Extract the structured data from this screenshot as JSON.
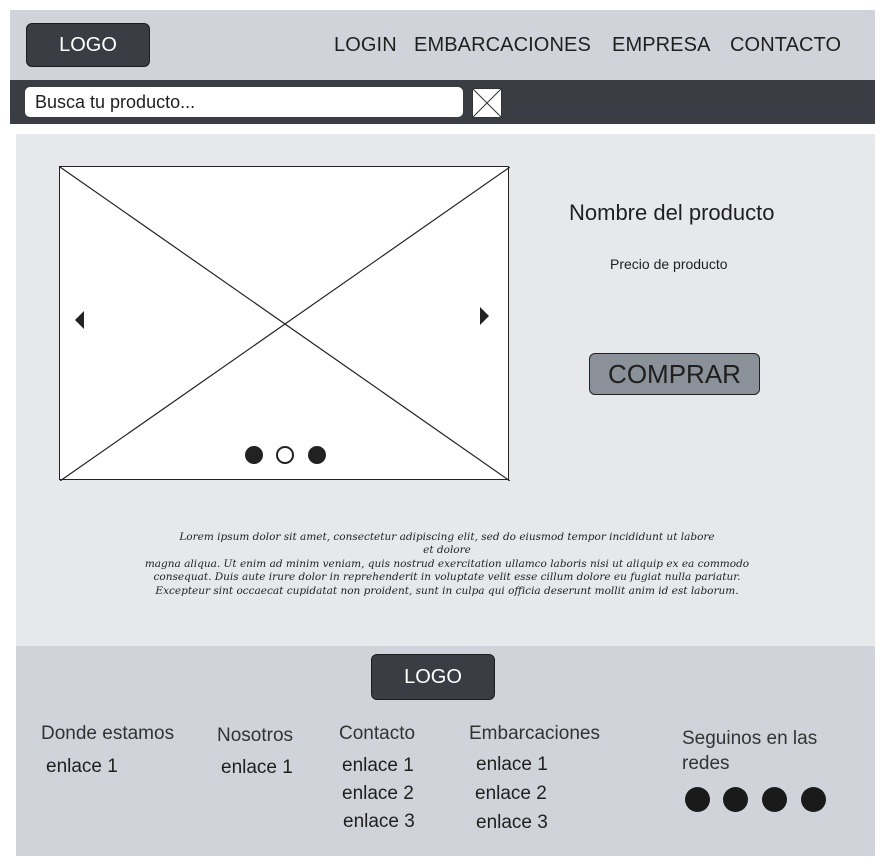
{
  "header": {
    "logo": "LOGO",
    "nav": [
      "LOGIN",
      "EMBARCACIONES",
      "EMPRESA",
      "CONTACTO"
    ]
  },
  "search": {
    "placeholder": "Busca tu producto..."
  },
  "product": {
    "carousel": {
      "slide_count": 3,
      "active_slide": 2
    },
    "name": "Nombre del producto",
    "price": "Precio de producto",
    "buy_label": "COMPRAR",
    "description": [
      "Lorem ipsum dolor sit amet, consectetur adipiscing elit, sed do eiusmod tempor incididunt ut labore",
      "et dolore",
      "magna aliqua. Ut enim ad minim veniam, quis nostrud exercitation ullamco laboris nisi ut aliquip ex ea commodo",
      "consequat. Duis aute irure dolor in reprehenderit in voluptate velit esse cillum dolore eu fugiat nulla pariatur.",
      "Excepteur sint occaecat cupidatat non proident, sunt in culpa qui officia deserunt mollit anim id est laborum."
    ]
  },
  "footer": {
    "logo": "LOGO",
    "columns": [
      {
        "title": "Donde estamos",
        "links": [
          "enlace 1"
        ]
      },
      {
        "title": "Nosotros",
        "links": [
          "enlace 1"
        ]
      },
      {
        "title": "Contacto",
        "links": [
          "enlace 1",
          "enlace 2",
          "enlace 3"
        ]
      },
      {
        "title": "Embarcaciones",
        "links": [
          "enlace 1",
          "enlace 2",
          "enlace 3"
        ]
      }
    ],
    "social": {
      "title": "Seguinos en las redes",
      "icon_count": 4
    }
  },
  "colors": {
    "header_bg": "#d0d4da",
    "search_bar_bg": "#3a3e44",
    "main_bg": "#e6e8ec",
    "button_dark": "#3a3e44",
    "buy_button": "#8b9198"
  }
}
